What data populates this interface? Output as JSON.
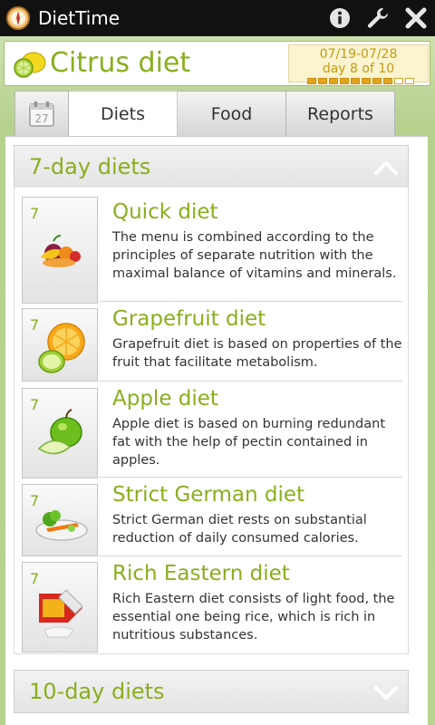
{
  "app": {
    "title": "DietTime"
  },
  "header": {
    "current_diet": "Citrus diet",
    "dates": "07/19-07/28",
    "day_progress": "day 8 of 10",
    "progress": {
      "current_day": 8,
      "total_days": 10
    }
  },
  "calendar": {
    "day": "27"
  },
  "tabs": [
    {
      "label": "Diets",
      "active": true
    },
    {
      "label": "Food",
      "active": false
    },
    {
      "label": "Reports",
      "active": false
    }
  ],
  "sections": [
    {
      "title": "7-day diets",
      "expanded": true,
      "items": [
        {
          "days": "7",
          "title": "Quick diet",
          "description": "The menu is combined according to the principles of separate nutrition with the maximal balance of vitamins and minerals.",
          "icon": "fruit-mix-icon"
        },
        {
          "days": "7",
          "title": "Grapefruit diet",
          "description": "Grapefruit diet is based on properties of the fruit that facilitate metabolism.",
          "icon": "grapefruit-icon"
        },
        {
          "days": "7",
          "title": "Apple diet",
          "description": "Apple diet is based on burning redundant fat with the help of pectin contained in apples.",
          "icon": "apple-icon"
        },
        {
          "days": "7",
          "title": "Strict German diet",
          "description": "Strict German diet rests on substantial reduction of daily consumed calories.",
          "icon": "vegetable-plate-icon"
        },
        {
          "days": "7",
          "title": "Rich Eastern diet",
          "description": "Rich Eastern diet consists of light food, the essential one being rice, which is rich in nutritious substances.",
          "icon": "rice-box-icon"
        }
      ]
    },
    {
      "title": "10-day diets",
      "expanded": false,
      "items": []
    }
  ],
  "colors": {
    "accent": "#8aae1e",
    "progress": "#e0a51c",
    "header_bg": "#b6d08e"
  }
}
